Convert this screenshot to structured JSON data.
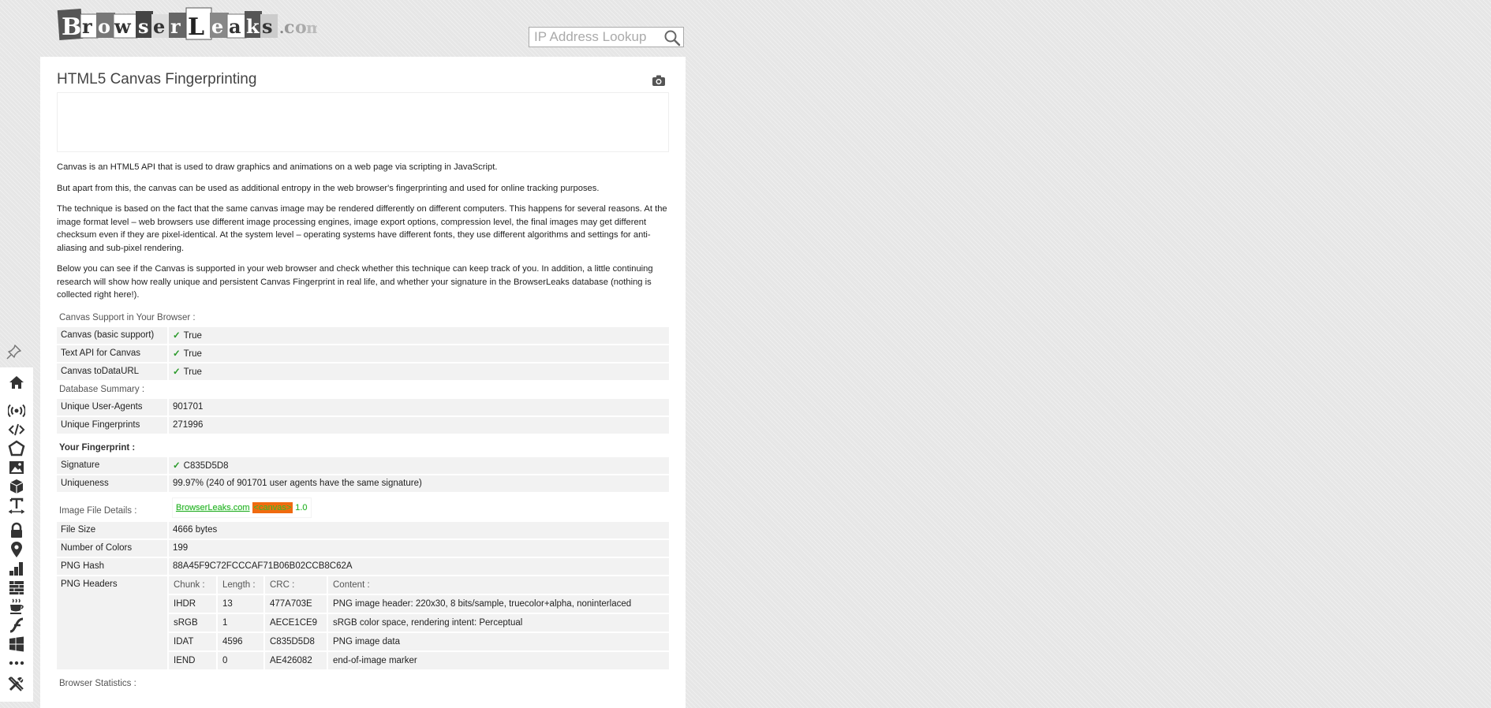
{
  "header": {
    "logo_text": "BrowserLeaks.com",
    "search_placeholder": "IP Address Lookup"
  },
  "page": {
    "title": "HTML5 Canvas Fingerprinting",
    "paragraphs": [
      "Canvas is an HTML5 API that is used to draw graphics and animations on a web page via scripting in JavaScript.",
      "But apart from this, the canvas can be used as additional entropy in the web browser's fingerprinting and used for online tracking purposes.",
      "The technique is based on the fact that the same canvas image may be rendered differently on different computers. This happens for several reasons. At the image format level – web browsers use different image processing engines, image export options, compression level, the final images may get different checksum even if they are pixel-identical. At the system level – operating systems have different fonts, they use different algorithms and settings for anti-aliasing and sub-pixel rendering.",
      "Below you can see if the Canvas is supported in your web browser and check whether this technique can keep track of you. In addition, a little continuing research will show how really unique and persistent Canvas Fingerprint in real life, and whether your signature in the BrowserLeaks database (nothing is collected right here!)."
    ]
  },
  "support": {
    "heading": "Canvas Support in Your Browser :",
    "rows": [
      {
        "key": "Canvas (basic support)",
        "check": "✓",
        "value": "True"
      },
      {
        "key": "Text API for Canvas",
        "check": "✓",
        "value": "True"
      },
      {
        "key": "Canvas toDataURL",
        "check": "✓",
        "value": "True"
      }
    ]
  },
  "database": {
    "heading": "Database Summary :",
    "rows": [
      {
        "key": "Unique User-Agents",
        "value": "901701"
      },
      {
        "key": "Unique Fingerprints",
        "value": "271996"
      }
    ]
  },
  "fingerprint": {
    "heading": "Your Fingerprint :",
    "signature_key": "Signature",
    "signature_check": "✓",
    "signature_value": "C835D5D8",
    "uniqueness_key": "Uniqueness",
    "uniqueness_value": "99.97% (240 of 901701 user agents have the same signature)"
  },
  "image_details": {
    "heading": "Image File Details :",
    "render_parts": [
      "BrowserLeaks.com",
      "<canvas>",
      "1.0"
    ],
    "rows": [
      {
        "key": "File Size",
        "value": "4666 bytes"
      },
      {
        "key": "Number of Colors",
        "value": "199"
      },
      {
        "key": "PNG Hash",
        "value": "88A45F9C72FCCCAF71B06B02CCB8C62A"
      }
    ],
    "png_headers_key": "PNG Headers",
    "png_columns": [
      "Chunk :",
      "Length :",
      "CRC :",
      "Content :"
    ],
    "png_rows": [
      {
        "chunk": "IHDR",
        "length": "13",
        "crc": "477A703E",
        "content": "PNG image header: 220x30, 8 bits/sample, truecolor+alpha, noninterlaced"
      },
      {
        "chunk": "sRGB",
        "length": "1",
        "crc": "AECE1CE9",
        "content": "sRGB color space, rendering intent: Perceptual"
      },
      {
        "chunk": "IDAT",
        "length": "4596",
        "crc": "C835D5D8",
        "content": "PNG image data"
      },
      {
        "chunk": "IEND",
        "length": "0",
        "crc": "AE426082",
        "content": "end-of-image marker"
      }
    ]
  },
  "stats": {
    "heading": "Browser Statistics :"
  },
  "sidebar": {
    "icons": [
      "pin-icon",
      "home-icon",
      "broadcast-icon",
      "code-icon",
      "flash-icon",
      "image-icon",
      "cube-icon",
      "font-icon",
      "lock-icon",
      "map-marker-icon",
      "stats-icon",
      "firewall-icon",
      "java-icon",
      "flash-player-icon",
      "windows-icon",
      "more-icon",
      "tools-icon"
    ]
  },
  "colors": {
    "check": "#2a9a2a",
    "row_bg": "#f2f2f2",
    "canvas_orange": "#f06a10"
  }
}
